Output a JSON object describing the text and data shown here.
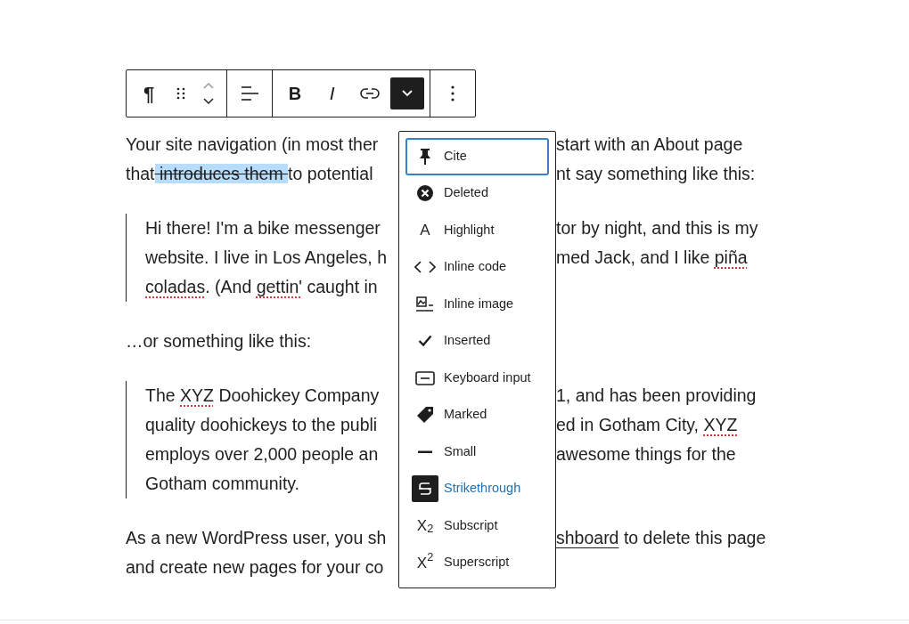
{
  "toolbar": {
    "groups": [
      [
        {
          "kind": "paragraph",
          "label": "¶",
          "selected": false
        },
        {
          "kind": "drag",
          "selected": false
        },
        {
          "kind": "move",
          "selected": false
        }
      ],
      [
        {
          "kind": "align",
          "selected": false
        }
      ],
      [
        {
          "kind": "bold",
          "label": "B",
          "selected": false
        },
        {
          "kind": "italic",
          "label": "I",
          "selected": false
        },
        {
          "kind": "link",
          "selected": false
        },
        {
          "kind": "more-formats",
          "selected": true
        }
      ],
      [
        {
          "kind": "options",
          "selected": false
        }
      ]
    ]
  },
  "blocks": [
    {
      "kind": "paragraph",
      "lines": [
        {
          "left": [
            {
              "text": "Your site navigation (in most ther",
              "kind": "plain"
            }
          ],
          "right": [
            {
              "text": "start with an About page",
              "kind": "plain"
            }
          ]
        },
        {
          "left": [
            {
              "text": "that",
              "kind": "plain"
            },
            {
              "text": " introduces them ",
              "kind": "strikethrough"
            },
            {
              "text": "to potential",
              "kind": "plain"
            }
          ],
          "right": [
            {
              "text": "nt say something like this:",
              "kind": "plain"
            }
          ]
        }
      ]
    },
    {
      "kind": "quote",
      "lines": [
        {
          "left": [
            {
              "text": "Hi there! I'm a bike messenger",
              "kind": "plain"
            }
          ],
          "right": [
            {
              "text": "tor by night, and this is my",
              "kind": "plain"
            }
          ]
        },
        {
          "left": [
            {
              "text": "website. I live in Los Angeles, h",
              "kind": "plain"
            }
          ],
          "right": [
            {
              "text": "med Jack, and I like ",
              "kind": "plain"
            },
            {
              "text": "piña",
              "kind": "misspelled"
            }
          ]
        },
        {
          "left": [
            {
              "text": "coladas",
              "kind": "misspelled"
            },
            {
              "text": ". (And ",
              "kind": "plain"
            },
            {
              "text": "gettin'",
              "kind": "misspelled"
            },
            {
              "text": " caught in",
              "kind": "plain"
            }
          ]
        }
      ]
    },
    {
      "kind": "paragraph",
      "lines": [
        {
          "left": [
            {
              "text": "…or something like this:",
              "kind": "plain"
            }
          ]
        }
      ]
    },
    {
      "kind": "quote",
      "lines": [
        {
          "left": [
            {
              "text": "The ",
              "kind": "plain"
            },
            {
              "text": "XYZ",
              "kind": "misspelled"
            },
            {
              "text": " Doohickey Company",
              "kind": "plain"
            }
          ],
          "right": [
            {
              "text": "1, and has been providing",
              "kind": "plain"
            }
          ]
        },
        {
          "left": [
            {
              "text": "quality doohickeys to the publi",
              "kind": "plain"
            }
          ],
          "right": [
            {
              "text": "ed in Gotham City, ",
              "kind": "plain"
            },
            {
              "text": "XYZ",
              "kind": "misspelled"
            }
          ]
        },
        {
          "left": [
            {
              "text": "employs over 2,000 people an",
              "kind": "plain"
            }
          ],
          "right": [
            {
              "text": "awesome things for the",
              "kind": "plain"
            }
          ]
        },
        {
          "left": [
            {
              "text": "Gotham community.",
              "kind": "plain"
            }
          ]
        }
      ]
    },
    {
      "kind": "paragraph",
      "lines": [
        {
          "left": [
            {
              "text": "As a new WordPress user, you sh",
              "kind": "plain"
            }
          ],
          "right": [
            {
              "text": "shboard",
              "kind": "link"
            },
            {
              "text": " to delete this page",
              "kind": "plain"
            }
          ]
        },
        {
          "left": [
            {
              "text": "and create new pages for your co",
              "kind": "plain"
            }
          ]
        }
      ]
    }
  ],
  "format_menu": {
    "items": [
      {
        "label": "Cite",
        "kind": "pin",
        "focused": true,
        "active": false
      },
      {
        "label": "Deleted",
        "kind": "x-circle",
        "focused": false,
        "active": false
      },
      {
        "label": "Highlight",
        "kind": "letter",
        "icon_text": "A",
        "focused": false,
        "active": false
      },
      {
        "label": "Inline code",
        "kind": "code",
        "focused": false,
        "active": false
      },
      {
        "label": "Inline image",
        "kind": "image",
        "focused": false,
        "active": false
      },
      {
        "label": "Inserted",
        "kind": "check",
        "focused": false,
        "active": false
      },
      {
        "label": "Keyboard input",
        "kind": "keyboard",
        "focused": false,
        "active": false
      },
      {
        "label": "Marked",
        "kind": "tag",
        "focused": false,
        "active": false
      },
      {
        "label": "Small",
        "kind": "dash",
        "focused": false,
        "active": false
      },
      {
        "label": "Strikethrough",
        "kind": "strike",
        "focused": false,
        "active": true
      },
      {
        "label": "Subscript",
        "kind": "letter",
        "icon_text": "X$_{2}$",
        "focused": false,
        "active": false
      },
      {
        "label": "Superscript",
        "kind": "letter",
        "icon_text": "X$^{2}$",
        "focused": false,
        "active": false
      }
    ]
  }
}
